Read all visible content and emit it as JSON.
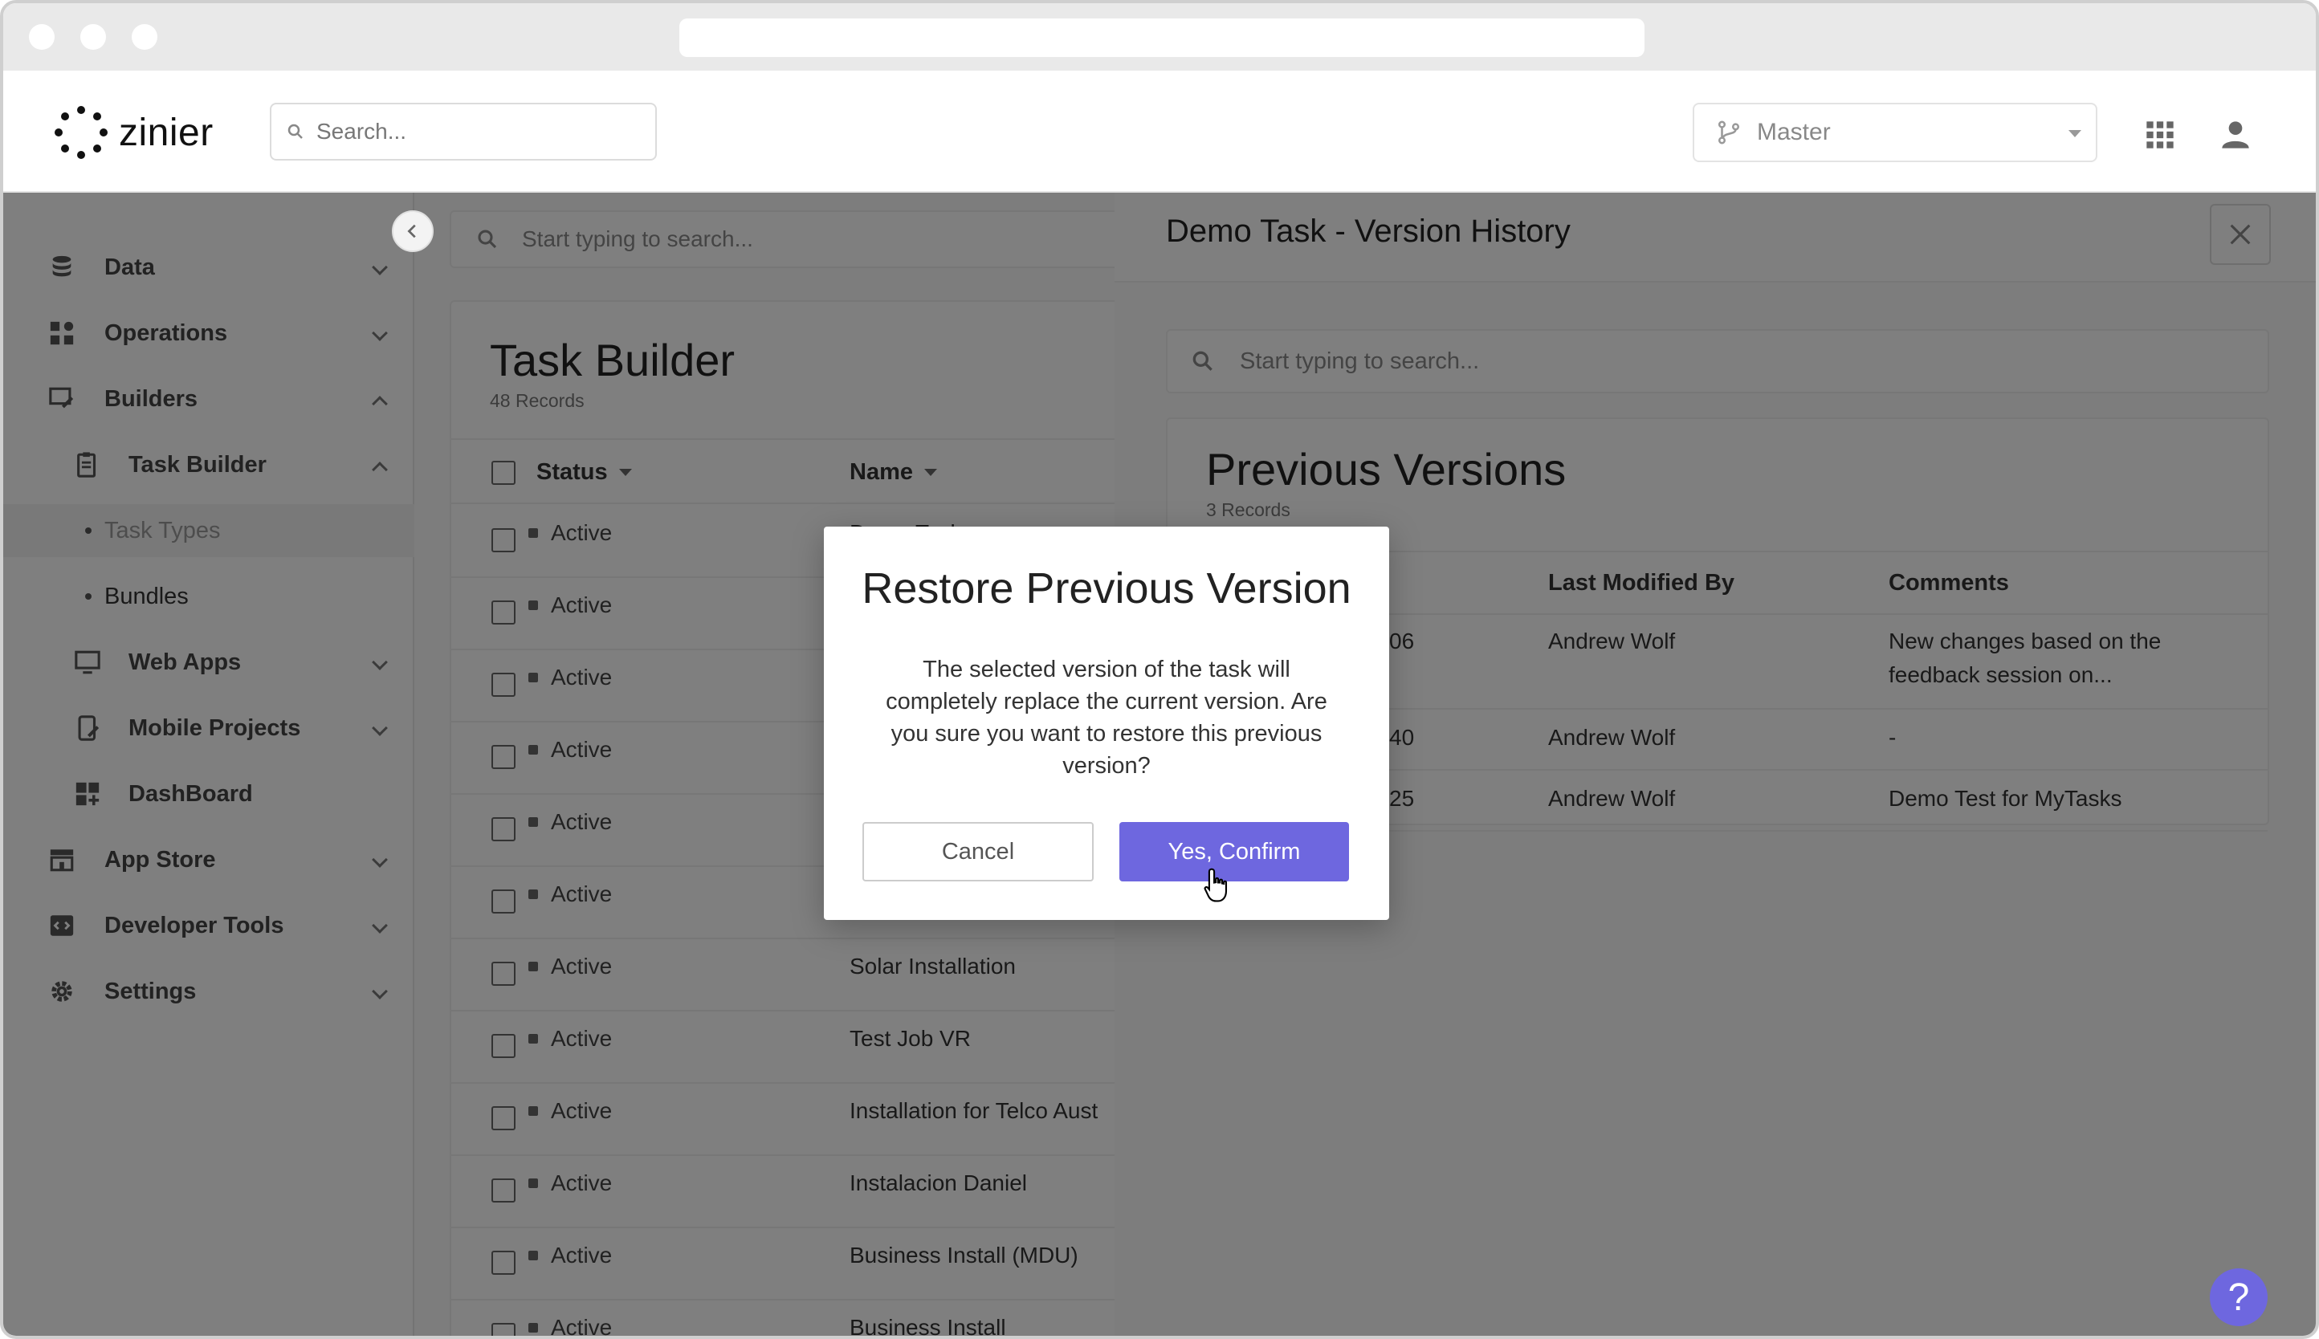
{
  "header": {
    "logo_text": "zinier",
    "search_placeholder": "Search...",
    "branch_label": "Master"
  },
  "sidebar": {
    "items": [
      {
        "label": "Data",
        "icon": "database-icon"
      },
      {
        "label": "Operations",
        "icon": "operations-icon"
      },
      {
        "label": "Builders",
        "icon": "builders-icon"
      },
      {
        "label": "Task Builder",
        "icon": "clipboard-icon"
      },
      {
        "label": "Task Types"
      },
      {
        "label": "Bundles"
      },
      {
        "label": "Web Apps",
        "icon": "monitor-icon"
      },
      {
        "label": "Mobile Projects",
        "icon": "mobile-icon"
      },
      {
        "label": "DashBoard",
        "icon": "dashboard-icon"
      },
      {
        "label": "App Store",
        "icon": "store-icon"
      },
      {
        "label": "Developer Tools",
        "icon": "code-icon"
      },
      {
        "label": "Settings",
        "icon": "gear-icon"
      }
    ]
  },
  "task_list": {
    "search_placeholder": "Start typing to search...",
    "title": "Task Builder",
    "record_count": "48 Records",
    "columns": [
      "Status",
      "Name"
    ],
    "rows": [
      {
        "status": "Active",
        "name": "Demo Task"
      },
      {
        "status": "Active",
        "name": ""
      },
      {
        "status": "Active",
        "name": ""
      },
      {
        "status": "Active",
        "name": ""
      },
      {
        "status": "Active",
        "name": ""
      },
      {
        "status": "Active",
        "name": ""
      },
      {
        "status": "Active",
        "name": "Solar Installation"
      },
      {
        "status": "Active",
        "name": "Test Job VR"
      },
      {
        "status": "Active",
        "name": "Installation for Telco Aust"
      },
      {
        "status": "Active",
        "name": "Instalacion Daniel"
      },
      {
        "status": "Active",
        "name": "Business Install (MDU)"
      },
      {
        "status": "Active",
        "name": "Business Install"
      }
    ]
  },
  "version_panel": {
    "title": "Demo Task - Version History",
    "search_placeholder": "Start typing to search...",
    "card_title": "Previous Versions",
    "record_count": "3 Records",
    "columns": [
      "",
      "Last Modified By",
      "Comments"
    ],
    "rows": [
      {
        "partial": "06",
        "modified_by": "Andrew Wolf",
        "comment": "New changes based on the feedback session on..."
      },
      {
        "partial": "40",
        "modified_by": "Andrew Wolf",
        "comment": "-"
      },
      {
        "partial": "25",
        "modified_by": "Andrew Wolf",
        "comment": "Demo Test for MyTasks"
      }
    ]
  },
  "modal": {
    "title": "Restore Previous Version",
    "message": "The selected version of the task will completely replace the current version. Are you sure you want to restore this previous version?",
    "cancel_label": "Cancel",
    "confirm_label": "Yes, Confirm"
  },
  "help_label": "?",
  "colors": {
    "accent": "#6e67df"
  }
}
